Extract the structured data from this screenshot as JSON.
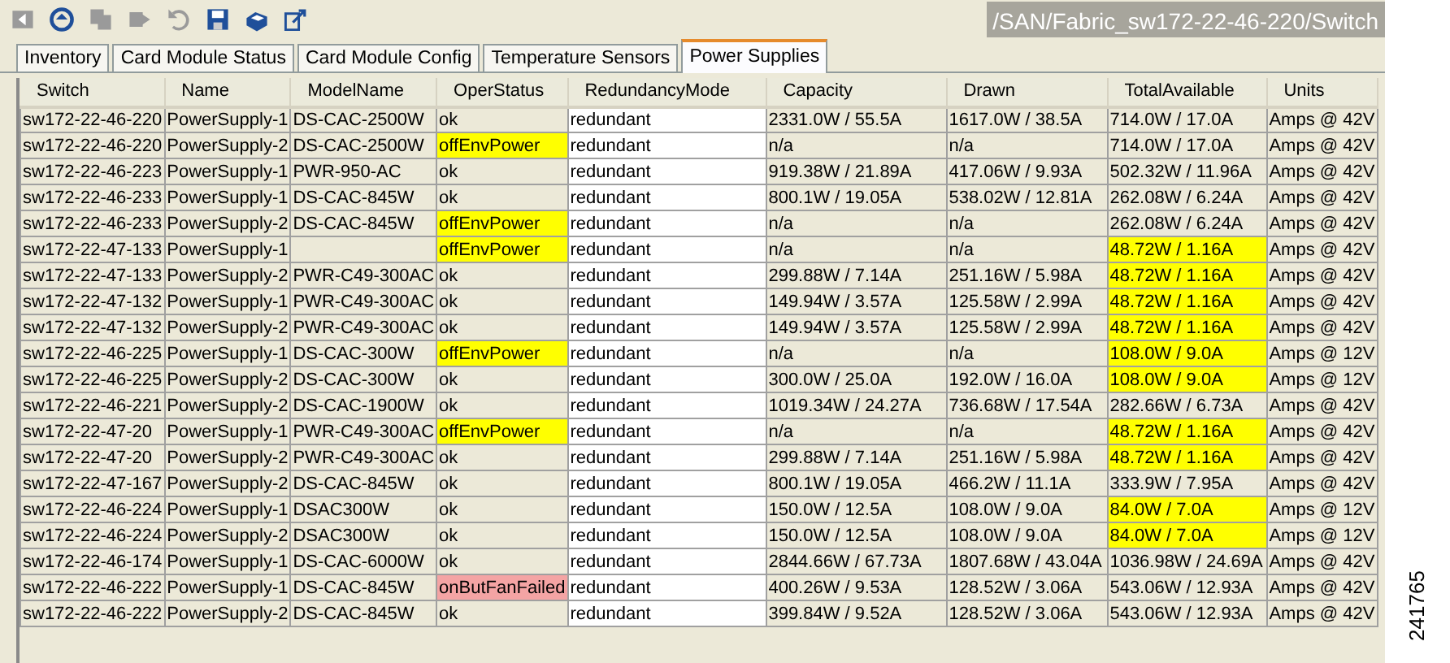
{
  "toolbar": {
    "buttons": [
      {
        "kind": "back",
        "disabled": true
      },
      {
        "kind": "refresh",
        "disabled": false
      },
      {
        "kind": "copy",
        "disabled": true
      },
      {
        "kind": "forward",
        "disabled": true
      },
      {
        "kind": "undo",
        "disabled": true
      },
      {
        "kind": "save",
        "disabled": false
      },
      {
        "kind": "print",
        "disabled": false
      },
      {
        "kind": "export",
        "disabled": false
      }
    ],
    "path": "/SAN/Fabric_sw172-22-46-220/Switch"
  },
  "tabs": [
    {
      "label": "Inventory",
      "selected": false
    },
    {
      "label": "Card Module Status",
      "selected": false
    },
    {
      "label": "Card Module Config",
      "selected": false
    },
    {
      "label": "Temperature Sensors",
      "selected": false
    },
    {
      "label": "Power Supplies",
      "selected": true
    }
  ],
  "table": {
    "columns": [
      "Switch",
      "Name",
      "ModelName",
      "OperStatus",
      "RedundancyMode",
      "Capacity",
      "Drawn",
      "TotalAvailable",
      "Units"
    ],
    "rows": [
      {
        "switch": "sw172-22-46-220",
        "name": "PowerSupply-1",
        "model": "DS-CAC-2500W",
        "oper_status": "ok",
        "redundancy": "redundant",
        "capacity": "2331.0W / 55.5A",
        "drawn": "1617.0W / 38.5A",
        "total": "714.0W / 17.0A",
        "total_alert": false,
        "units": "Amps @ 42V"
      },
      {
        "switch": "sw172-22-46-220",
        "name": "PowerSupply-2",
        "model": "DS-CAC-2500W",
        "oper_status": "offEnvPower",
        "oper_warning": true,
        "redundancy": "redundant",
        "capacity": "n/a",
        "drawn": "n/a",
        "total": "714.0W / 17.0A",
        "total_alert": false,
        "units": "Amps @ 42V"
      },
      {
        "switch": "sw172-22-46-223",
        "name": "PowerSupply-1",
        "model": "PWR-950-AC",
        "oper_status": "ok",
        "redundancy": "redundant",
        "capacity": "919.38W / 21.89A",
        "drawn": "417.06W / 9.93A",
        "total": "502.32W / 11.96A",
        "total_alert": false,
        "units": "Amps @ 42V"
      },
      {
        "switch": "sw172-22-46-233",
        "name": "PowerSupply-1",
        "model": "DS-CAC-845W",
        "oper_status": "ok",
        "redundancy": "redundant",
        "capacity": "800.1W / 19.05A",
        "drawn": "538.02W / 12.81A",
        "total": "262.08W / 6.24A",
        "total_alert": false,
        "units": "Amps @ 42V"
      },
      {
        "switch": "sw172-22-46-233",
        "name": "PowerSupply-2",
        "model": "DS-CAC-845W",
        "oper_status": "offEnvPower",
        "oper_warning": true,
        "redundancy": "redundant",
        "capacity": "n/a",
        "drawn": "n/a",
        "total": "262.08W / 6.24A",
        "total_alert": false,
        "units": "Amps @ 42V"
      },
      {
        "switch": "sw172-22-47-133",
        "name": "PowerSupply-1",
        "oper_status": "offEnvPower",
        "oper_warning": true,
        "redundancy": "redundant",
        "capacity": "n/a",
        "drawn": "n/a",
        "total": "48.72W / 1.16A",
        "total_alert": true,
        "units": "Amps @ 42V"
      },
      {
        "switch": "sw172-22-47-133",
        "name": "PowerSupply-2",
        "model": "PWR-C49-300AC",
        "oper_status": "ok",
        "redundancy": "redundant",
        "capacity": "299.88W / 7.14A",
        "drawn": "251.16W / 5.98A",
        "total": "48.72W / 1.16A",
        "total_alert": true,
        "units": "Amps @ 42V"
      },
      {
        "switch": "sw172-22-47-132",
        "name": "PowerSupply-1",
        "model": "PWR-C49-300AC",
        "oper_status": "ok",
        "redundancy": "redundant",
        "capacity": "149.94W / 3.57A",
        "drawn": "125.58W / 2.99A",
        "total": "48.72W / 1.16A",
        "total_alert": true,
        "units": "Amps @ 42V"
      },
      {
        "switch": "sw172-22-47-132",
        "name": "PowerSupply-2",
        "model": "PWR-C49-300AC",
        "oper_status": "ok",
        "redundancy": "redundant",
        "capacity": "149.94W / 3.57A",
        "drawn": "125.58W / 2.99A",
        "total": "48.72W / 1.16A",
        "total_alert": true,
        "units": "Amps @ 42V"
      },
      {
        "switch": "sw172-22-46-225",
        "name": "PowerSupply-1",
        "model": "DS-CAC-300W",
        "oper_status": "offEnvPower",
        "oper_warning": true,
        "redundancy": "redundant",
        "capacity": "n/a",
        "drawn": "n/a",
        "total": "108.0W / 9.0A",
        "total_alert": true,
        "units": "Amps @ 12V"
      },
      {
        "switch": "sw172-22-46-225",
        "name": "PowerSupply-2",
        "model": "DS-CAC-300W",
        "oper_status": "ok",
        "redundancy": "redundant",
        "capacity": "300.0W / 25.0A",
        "drawn": "192.0W / 16.0A",
        "total": "108.0W / 9.0A",
        "total_alert": true,
        "units": "Amps @ 12V"
      },
      {
        "switch": "sw172-22-46-221",
        "name": "PowerSupply-2",
        "model": "DS-CAC-1900W",
        "oper_status": "ok",
        "redundancy": "redundant",
        "capacity": "1019.34W / 24.27A",
        "drawn": "736.68W / 17.54A",
        "total": "282.66W / 6.73A",
        "total_alert": false,
        "units": "Amps @ 42V"
      },
      {
        "switch": "sw172-22-47-20",
        "name": "PowerSupply-1",
        "model": "PWR-C49-300AC",
        "oper_status": "offEnvPower",
        "oper_warning": true,
        "redundancy": "redundant",
        "capacity": "n/a",
        "drawn": "n/a",
        "total": "48.72W / 1.16A",
        "total_alert": true,
        "units": "Amps @ 42V"
      },
      {
        "switch": "sw172-22-47-20",
        "name": "PowerSupply-2",
        "model": "PWR-C49-300AC",
        "oper_status": "ok",
        "redundancy": "redundant",
        "capacity": "299.88W / 7.14A",
        "drawn": "251.16W / 5.98A",
        "total": "48.72W / 1.16A",
        "total_alert": true,
        "units": "Amps @ 42V"
      },
      {
        "switch": "sw172-22-47-167",
        "name": "PowerSupply-2",
        "model": "DS-CAC-845W",
        "oper_status": "ok",
        "redundancy": "redundant",
        "capacity": "800.1W / 19.05A",
        "drawn": "466.2W / 11.1A",
        "total": "333.9W / 7.95A",
        "total_alert": false,
        "units": "Amps @ 42V"
      },
      {
        "switch": "sw172-22-46-224",
        "name": "PowerSupply-1",
        "model": "DSAC300W",
        "oper_status": "ok",
        "redundancy": "redundant",
        "capacity": "150.0W / 12.5A",
        "drawn": "108.0W / 9.0A",
        "total": "84.0W / 7.0A",
        "total_alert": true,
        "units": "Amps @ 12V"
      },
      {
        "switch": "sw172-22-46-224",
        "name": "PowerSupply-2",
        "model": "DSAC300W",
        "oper_status": "ok",
        "redundancy": "redundant",
        "capacity": "150.0W / 12.5A",
        "drawn": "108.0W / 9.0A",
        "total": "84.0W / 7.0A",
        "total_alert": true,
        "units": "Amps @ 12V"
      },
      {
        "switch": "sw172-22-46-174",
        "name": "PowerSupply-1",
        "model": "DS-CAC-6000W",
        "oper_status": "ok",
        "redundancy": "redundant",
        "capacity": "2844.66W / 67.73A",
        "drawn": "1807.68W / 43.04A",
        "total": "1036.98W / 24.69A",
        "total_alert": false,
        "units": "Amps @ 42V"
      },
      {
        "switch": "sw172-22-46-222",
        "name": "PowerSupply-1",
        "model": "DS-CAC-845W",
        "oper_status": "onButFanFailed",
        "oper_fault": true,
        "redundancy": "redundant",
        "capacity": "400.26W / 9.53A",
        "drawn": "128.52W / 3.06A",
        "total": "543.06W / 12.93A",
        "total_alert": false,
        "units": "Amps @ 42V"
      },
      {
        "switch": "sw172-22-46-222",
        "name": "PowerSupply-2",
        "model": "DS-CAC-845W",
        "oper_status": "ok",
        "redundancy": "redundant",
        "capacity": "399.84W / 9.52A",
        "drawn": "128.52W / 3.06A",
        "total": "543.06W / 12.93A",
        "total_alert": false,
        "units": "Amps @ 42V"
      }
    ]
  },
  "figure_number": "241765"
}
